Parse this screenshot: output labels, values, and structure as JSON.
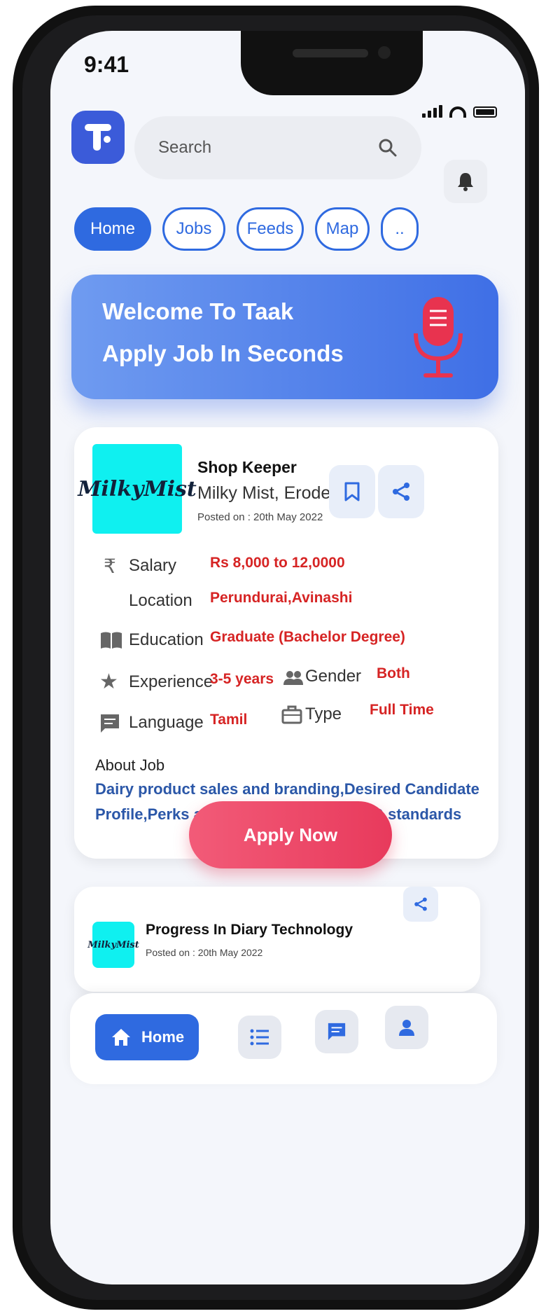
{
  "status_bar": {
    "time": "9:41"
  },
  "search": {
    "placeholder": "Search"
  },
  "tabs": [
    {
      "label": "Home",
      "active": true
    },
    {
      "label": "Jobs",
      "active": false
    },
    {
      "label": "Feeds",
      "active": false
    },
    {
      "label": "Map",
      "active": false
    },
    {
      "label": "..",
      "active": false
    }
  ],
  "banner": {
    "line1": "Welcome To Taak",
    "line2": "Apply Job In Seconds",
    "icon": "microphone-icon"
  },
  "job": {
    "logo_text": "MilkyMist",
    "title": "Shop Keeper",
    "company": "Milky Mist, Erode",
    "posted": "Posted on : 20th May 2022",
    "salary_label": "Salary",
    "salary_value": "Rs 8,000 to 12,0000",
    "location_label": "Location",
    "location_value": "Perundurai,Avinashi",
    "education_label": "Education",
    "education_value": "Graduate  (Bachelor Degree)",
    "experience_label": "Experience",
    "experience_value": "3-5 years",
    "gender_label": "Gender",
    "gender_value": "Both",
    "language_label": "Language",
    "language_value": "Tamil",
    "type_label": "Type",
    "type_value": "Full Time",
    "about_label": "About Job",
    "about_line1": "Dairy product sales and branding,Desired Candidate",
    "about_line2": "Profile,Perks and BenefitsAs per FMCG standards",
    "apply_label": "Apply Now"
  },
  "job2": {
    "logo_text": "MilkyMist",
    "title": "Progress  In Diary Technology",
    "posted": "Posted on : 20th May 2022"
  },
  "bottom_nav": {
    "home_label": "Home"
  },
  "colors": {
    "accent": "#2f6ae0",
    "value_red": "#d62424",
    "apply": "#ee4b6a",
    "logo_bg": "#0ff0f0"
  }
}
